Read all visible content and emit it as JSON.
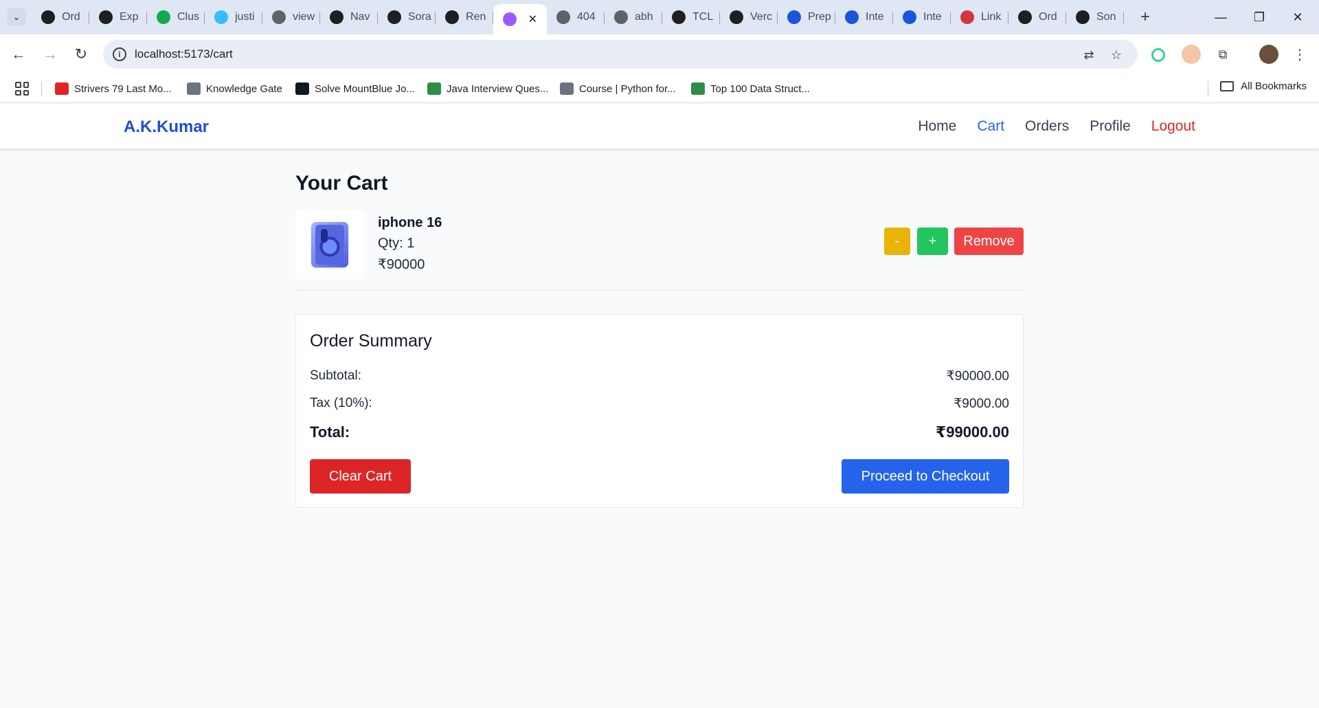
{
  "browser": {
    "tabs": [
      {
        "title": "Ord",
        "icon": "openai-icon",
        "color": "#1f1f1f"
      },
      {
        "title": "Exp",
        "icon": "express-icon",
        "color": "#1f1f1f"
      },
      {
        "title": "Clus",
        "icon": "mongodb-leaf-icon",
        "color": "#13aa52"
      },
      {
        "title": "justi",
        "icon": "tailwind-icon",
        "color": "#38bdf8"
      },
      {
        "title": "view",
        "icon": "globe-icon",
        "color": "#5f6368"
      },
      {
        "title": "Nav",
        "icon": "openai-icon",
        "color": "#1f1f1f"
      },
      {
        "title": "Sora",
        "icon": "play-icon",
        "color": "#1f1f1f"
      },
      {
        "title": "Ren",
        "icon": "render-icon",
        "color": "#1f1f1f"
      },
      {
        "title": "",
        "icon": "vite-icon",
        "color": "#9b5cff",
        "active": true
      },
      {
        "title": "404",
        "icon": "globe-icon",
        "color": "#5f6368"
      },
      {
        "title": "abh",
        "icon": "globe-icon",
        "color": "#5f6368"
      },
      {
        "title": "TCL",
        "icon": "amazon-icon",
        "color": "#1f1f1f"
      },
      {
        "title": "Verc",
        "icon": "vercel-icon",
        "color": "#1f1f1f"
      },
      {
        "title": "Prep",
        "icon": "brand-icon",
        "color": "#1a56db"
      },
      {
        "title": "Inte",
        "icon": "brand-icon",
        "color": "#1a56db"
      },
      {
        "title": "Inte",
        "icon": "brand-icon",
        "color": "#1a56db"
      },
      {
        "title": "Link",
        "icon": "linktree-icon",
        "color": "#d1373c"
      },
      {
        "title": "Ord",
        "icon": "openai-icon",
        "color": "#1f1f1f"
      },
      {
        "title": "Son",
        "icon": "amazon-icon",
        "color": "#1f1f1f"
      }
    ],
    "url": "localhost:5173/cart",
    "bookmarks": [
      {
        "label": "Strivers 79 Last Mo...",
        "icon": "tuf-icon",
        "color": "#e02424"
      },
      {
        "label": "Knowledge Gate",
        "icon": "kg-icon",
        "color": "#6b7280"
      },
      {
        "label": "Solve MountBlue Jo...",
        "icon": "hackerearth-icon",
        "color": "#111827"
      },
      {
        "label": "Java Interview Ques...",
        "icon": "gfg-icon",
        "color": "#2f8d46"
      },
      {
        "label": "Course | Python for...",
        "icon": "course-icon",
        "color": "#6b7280"
      },
      {
        "label": "Top 100 Data Struct...",
        "icon": "gfg-icon",
        "color": "#2f8d46"
      }
    ],
    "all_bookmarks_label": "All Bookmarks"
  },
  "app": {
    "brand": "A.K.Kumar",
    "nav": {
      "home": "Home",
      "cart": "Cart",
      "orders": "Orders",
      "profile": "Profile",
      "logout": "Logout"
    },
    "page_title": "Your Cart",
    "items": [
      {
        "name": "iphone 16",
        "qty": "Qty: 1",
        "price": "₹90000",
        "dec_label": "-",
        "inc_label": "+",
        "remove_label": "Remove"
      }
    ],
    "summary": {
      "title": "Order Summary",
      "subtotal_label": "Subtotal:",
      "subtotal_value": "₹90000.00",
      "tax_label": "Tax (10%):",
      "tax_value": "₹9000.00",
      "total_label": "Total:",
      "total_value": "₹99000.00",
      "clear_label": "Clear Cart",
      "checkout_label": "Proceed to Checkout"
    },
    "colors": {
      "brand": "#1d4ed8",
      "active_link": "#2563eb",
      "logout": "#dc2626",
      "decrement": "#eab308",
      "increment": "#22c55e",
      "remove": "#ef4444",
      "checkout": "#2563eb",
      "clear": "#dc2626"
    }
  }
}
